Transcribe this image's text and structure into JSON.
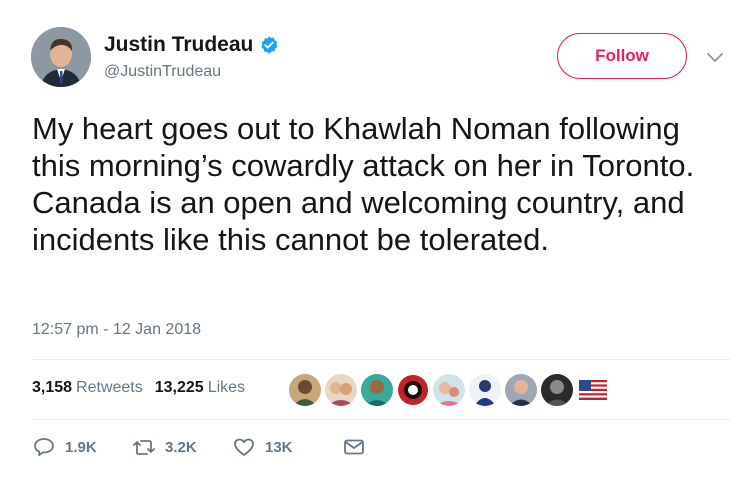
{
  "author": {
    "name": "Justin Trudeau",
    "handle": "@JustinTrudeau",
    "verified": true
  },
  "follow_label": "Follow",
  "tweet": {
    "text": "My heart goes out to Khawlah Noman following this morning’s cowardly attack on her in Toronto. Canada is an open and welcoming country, and incidents like this cannot be tolerated.",
    "timestamp": "12:57 pm - 12 Jan 2018"
  },
  "stats": {
    "retweets_count": "3,158",
    "retweets_label": "Retweets",
    "likes_count": "13,225",
    "likes_label": "Likes"
  },
  "actions": {
    "replies": "1.9K",
    "retweets": "3.2K",
    "likes": "13K"
  },
  "colors": {
    "follow_accent": "#e0245e",
    "verified_blue": "#1da1f2",
    "muted_text": "#657786"
  },
  "icons": [
    "verified-badge-icon",
    "chevron-down-icon",
    "reply-icon",
    "retweet-icon",
    "like-icon",
    "direct-message-icon",
    "us-flag-icon"
  ]
}
